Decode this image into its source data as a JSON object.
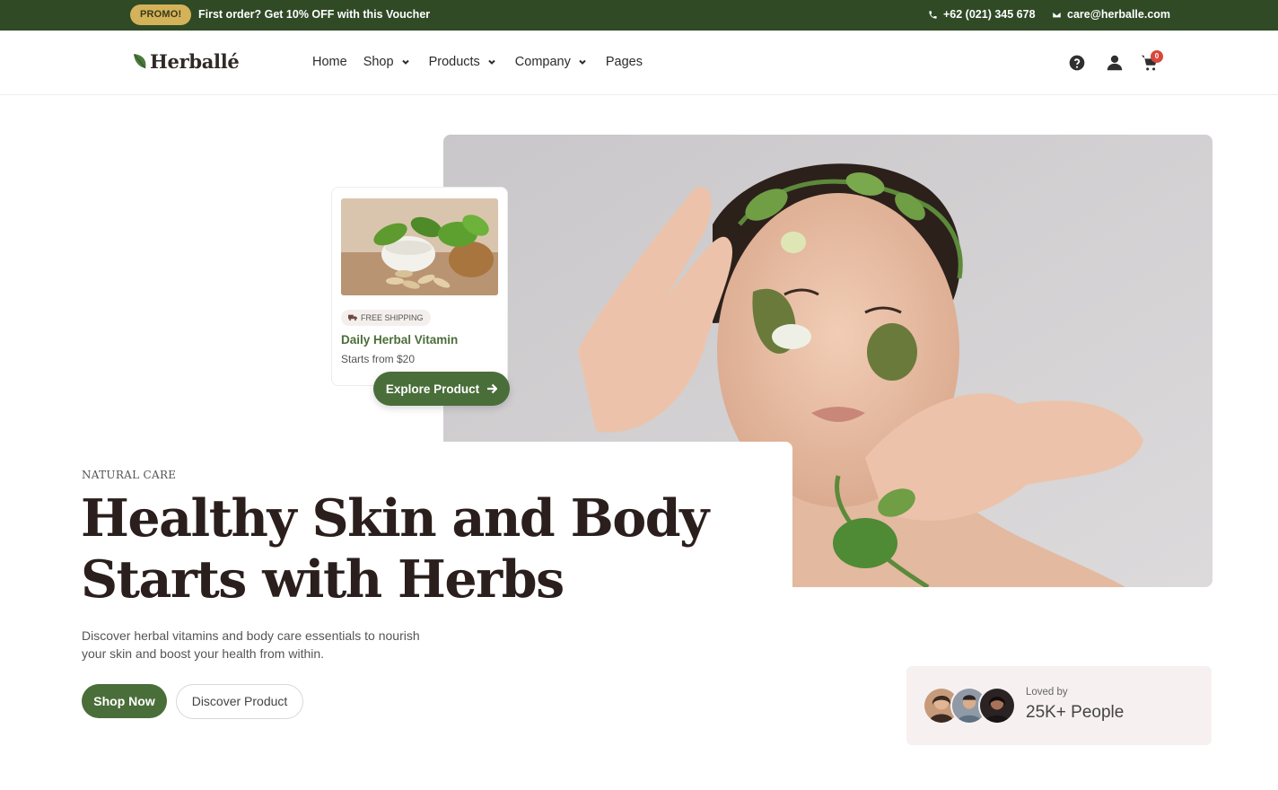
{
  "topbar": {
    "promo_badge": "PROMO!",
    "promo_text": "First order? Get 10% OFF with this Voucher",
    "phone": "+62 (021) 345 678",
    "email": "care@herballe.com"
  },
  "header": {
    "logo_text": "Herballé",
    "nav": [
      {
        "label": "Home",
        "has_dropdown": false
      },
      {
        "label": "Shop",
        "has_dropdown": true
      },
      {
        "label": "Products",
        "has_dropdown": true
      },
      {
        "label": "Company",
        "has_dropdown": true
      },
      {
        "label": "Pages",
        "has_dropdown": false
      }
    ],
    "icons": [
      "help-icon",
      "user-icon",
      "cart-icon"
    ],
    "cart_count": "0"
  },
  "product_card": {
    "badge": "FREE SHIPPING",
    "title": "Daily Herbal Vitamin",
    "price": "Starts from $20",
    "cta": "Explore Product"
  },
  "hero": {
    "eyebrow": "NATURAL CARE",
    "headline_line1": "Healthy Skin and Body",
    "headline_line2": "Starts with Herbs",
    "subtext": "Discover herbal vitamins and body care essentials to nourish your skin and boost your health from within.",
    "primary_cta": "Shop Now",
    "secondary_cta": "Discover Product"
  },
  "social_proof": {
    "label": "Loved by",
    "count": "25K+ People"
  },
  "colors": {
    "brand_green": "#4a6e3a",
    "topbar_green": "#2f4a25",
    "promo_gold": "#d4b25a",
    "heading": "#2a1f1c",
    "cart_badge": "#d9473b"
  }
}
